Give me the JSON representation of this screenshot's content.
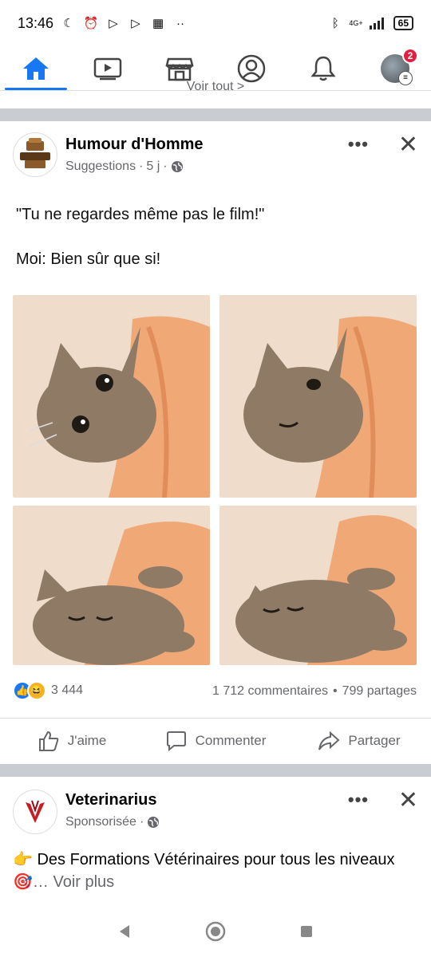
{
  "status_bar": {
    "time": "13:46",
    "network": "4G+",
    "battery": "65"
  },
  "nav": {
    "notifications_count": "2"
  },
  "feed": {
    "voir_tout": "Voir tout >"
  },
  "post1": {
    "page_name": "Humour d'Homme",
    "meta_label": "Suggestions",
    "meta_time": "5 j",
    "meme_line1": "\"Tu ne regardes même pas le film!\"",
    "meme_line2": "Moi: Bien sûr que si!",
    "reactions_count": "3 444",
    "comments": "1 712 commentaires",
    "shares": "799 partages",
    "like_label": "J'aime",
    "comment_label": "Commenter",
    "share_label": "Partager"
  },
  "post2": {
    "page_name": "Veterinarius",
    "meta_label": "Sponsorisée",
    "text": "Des Formations Vétérinaires pour tous les niveaux",
    "see_more": "… Voir plus"
  },
  "colors": {
    "accent": "#1877f2",
    "badge": "#e41e3f",
    "separator": "#c9ccd1",
    "secondary_text": "#65676b"
  }
}
